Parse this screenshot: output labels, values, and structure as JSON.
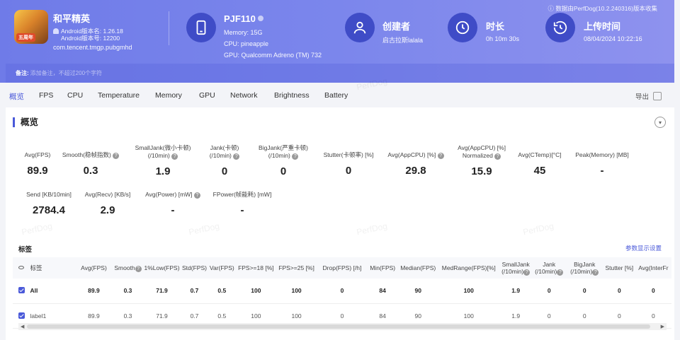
{
  "header": {
    "source": "数据由PerfDog(10.2.240316)版本收集",
    "app": {
      "name": "和平精英",
      "android_version_name": "Android版本名: 1.26.18",
      "android_version_code": "Android版本号: 12200",
      "package": "com.tencent.tmgp.pubgmhd",
      "badge": "五周年"
    },
    "device": {
      "model": "PJF110",
      "memory": "Memory: 15G",
      "cpu": "CPU: pineapple",
      "gpu": "GPU: Qualcomm Adreno (TM) 732"
    },
    "creator": {
      "title": "创建者",
      "value": "启古拉斯lalala"
    },
    "duration": {
      "title": "时长",
      "value": "0h 10m 30s"
    },
    "upload": {
      "title": "上传时间",
      "value": "08/04/2024 10:22:16"
    },
    "remark": {
      "label": "备注:",
      "placeholder": "添加备注，不超过200个字符"
    }
  },
  "tabs": [
    "概览",
    "FPS",
    "CPU",
    "Temperature",
    "Memory",
    "GPU",
    "Network",
    "Brightness",
    "Battery"
  ],
  "export_label": "导出",
  "overview": {
    "title": "概览",
    "row1": [
      {
        "label": "Avg(FPS)",
        "value": "89.9"
      },
      {
        "label": "Smooth(稳帧指数)",
        "value": "0.3"
      },
      {
        "label": "SmallJank(微小卡顿)",
        "label2": "(/10min)",
        "value": "1.9"
      },
      {
        "label": "Jank(卡顿)",
        "label2": "(/10min)",
        "value": "0"
      },
      {
        "label": "BigJank(严重卡顿)",
        "label2": "(/10min)",
        "value": "0"
      },
      {
        "label": "Stutter(卡顿率) [%]",
        "value": "0"
      },
      {
        "label": "Avg(AppCPU) [%]",
        "value": "29.8"
      },
      {
        "label": "Avg(AppCPU) [%]",
        "label2": "Normalized",
        "value": "15.9"
      },
      {
        "label": "Avg(CTemp)[°C]",
        "value": "45"
      },
      {
        "label": "Peak(Memory) [MB]",
        "value": "-"
      }
    ],
    "row2": [
      {
        "label": "Send [KB/10min]",
        "value": "2784.4"
      },
      {
        "label": "Avg(Recv) [KB/s]",
        "value": "2.9"
      },
      {
        "label": "Avg(Power) [mW]",
        "value": "-"
      },
      {
        "label": "FPower(帧能耗) [mW]",
        "value": "-"
      }
    ]
  },
  "labels_section": {
    "title": "标签",
    "settings_link": "参数显示设置",
    "columns": [
      "标签",
      "Avg(FPS)",
      "Smooth",
      "1%Low(FPS)",
      "Std(FPS)",
      "Var(FPS)",
      "FPS>=18 [%]",
      "FPS>=25 [%]",
      "Drop(FPS) [/h]",
      "Min(FPS)",
      "Median(FPS)",
      "MedRange(FPS)[%]",
      "SmallJank (/10min)",
      "Jank (/10min)",
      "BigJank (/10min)",
      "Stutter [%]",
      "Avg(InterFr"
    ],
    "rows": [
      {
        "name": "All",
        "cells": [
          "89.9",
          "0.3",
          "71.9",
          "0.7",
          "0.5",
          "100",
          "100",
          "0",
          "84",
          "90",
          "100",
          "1.9",
          "0",
          "0",
          "0",
          "0"
        ]
      },
      {
        "name": "label1",
        "cells": [
          "89.9",
          "0.3",
          "71.9",
          "0.7",
          "0.5",
          "100",
          "100",
          "0",
          "84",
          "90",
          "100",
          "1.9",
          "0",
          "0",
          "0",
          "0"
        ]
      }
    ]
  },
  "watermark": "PerfDog",
  "colors": {
    "header_start": "#6f7be8",
    "accent": "#4a59d9",
    "circle_bg": "#3f4cc7"
  }
}
